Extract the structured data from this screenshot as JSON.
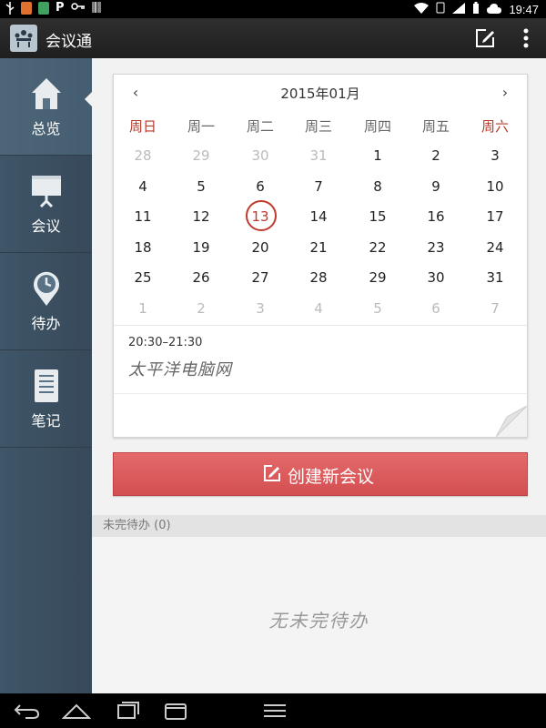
{
  "status_bar": {
    "left_icons": [
      "usb-icon",
      "app-icon",
      "app-icon",
      "p-icon",
      "key-icon",
      "barcode-icon"
    ],
    "p_glyph": "P",
    "time": "19:47"
  },
  "action_bar": {
    "title": "会议通",
    "actions": [
      "edit-icon",
      "overflow-menu-icon"
    ]
  },
  "sidebar": {
    "items": [
      {
        "label": "总览",
        "icon": "home-icon",
        "active": true
      },
      {
        "label": "会议",
        "icon": "presentation-icon",
        "active": false
      },
      {
        "label": "待办",
        "icon": "clock-pin-icon",
        "active": false
      },
      {
        "label": "笔记",
        "icon": "notebook-icon",
        "active": false
      }
    ]
  },
  "calendar": {
    "prev": "‹",
    "next": "›",
    "month_title": "2015年01月",
    "weekdays": [
      "周日",
      "周一",
      "周二",
      "周三",
      "周四",
      "周五",
      "周六"
    ],
    "weeks": [
      [
        "28",
        "29",
        "30",
        "31",
        "1",
        "2",
        "3"
      ],
      [
        "4",
        "5",
        "6",
        "7",
        "8",
        "9",
        "10"
      ],
      [
        "11",
        "12",
        "13",
        "14",
        "15",
        "16",
        "17"
      ],
      [
        "18",
        "19",
        "20",
        "21",
        "22",
        "23",
        "24"
      ],
      [
        "25",
        "26",
        "27",
        "28",
        "29",
        "30",
        "31"
      ],
      [
        "1",
        "2",
        "3",
        "4",
        "5",
        "6",
        "7"
      ]
    ],
    "today": "13",
    "event": {
      "time": "20:30–21:30",
      "title": "太平洋电脑网"
    }
  },
  "create_button": {
    "label": "创建新会议"
  },
  "pending": {
    "header": "未完待办 (0)",
    "empty_text": "无未完待办"
  },
  "nav_bar": [
    "back-icon",
    "home-icon",
    "recents-icon",
    "screenshot-icon",
    "menu-icon"
  ],
  "colors": {
    "accent_red": "#d44f51",
    "weekend_red": "#b53a2a",
    "sidebar_blue": "#3e5668"
  }
}
